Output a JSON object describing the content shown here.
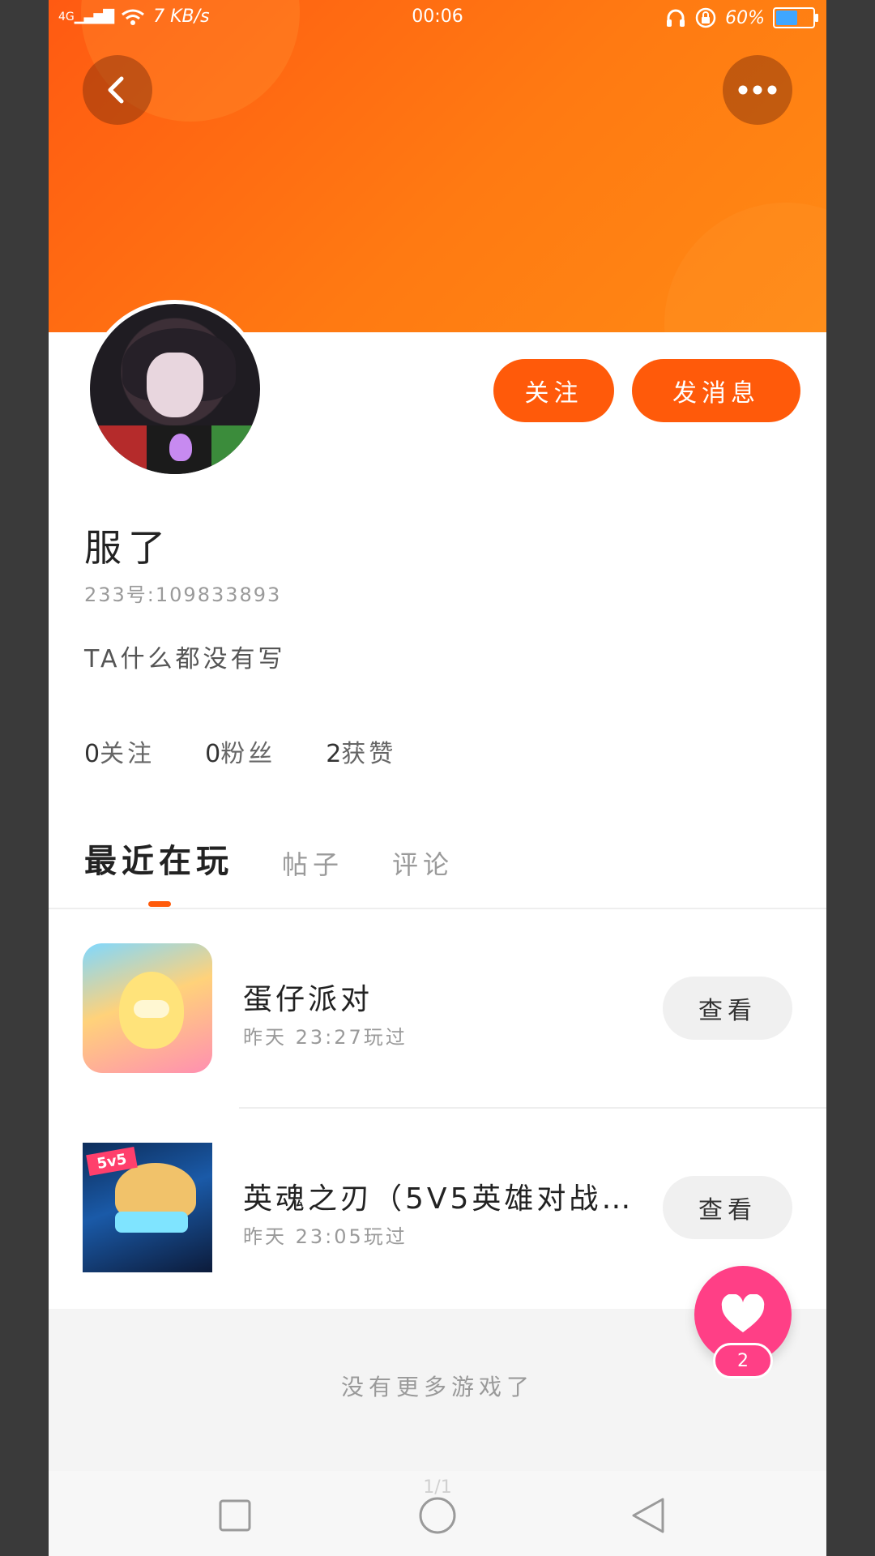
{
  "status_bar": {
    "network": "4G",
    "speed": "7 KB/s",
    "time": "00:06",
    "battery": "60%",
    "battery_level": 0.6
  },
  "header": {
    "back_icon": "chevron-left-icon",
    "more_icon": "more-horizontal-icon"
  },
  "actions": {
    "follow_label": "关注",
    "message_label": "发消息"
  },
  "profile": {
    "username": "服了",
    "id_line": "233号:109833893",
    "bio": "TA什么都没有写"
  },
  "stats": [
    {
      "num": "0",
      "label": "关注"
    },
    {
      "num": "0",
      "label": "粉丝"
    },
    {
      "num": "2",
      "label": "获赞"
    }
  ],
  "tabs": [
    {
      "label": "最近在玩",
      "active": true
    },
    {
      "label": "帖子",
      "active": false
    },
    {
      "label": "评论",
      "active": false
    }
  ],
  "games": [
    {
      "title": "蛋仔派对",
      "time": "昨天 23:27玩过",
      "button": "查看"
    },
    {
      "title": "英魂之刃（5V5英雄对战…",
      "time": "昨天 23:05玩过",
      "button": "查看"
    }
  ],
  "footer": {
    "no_more": "没有更多游戏了"
  },
  "like": {
    "count": "2",
    "icon": "heart-icon"
  },
  "nav": {
    "page_indicator": "1/1"
  },
  "colors": {
    "accent": "#ff5a0a",
    "like": "#ff3f86"
  }
}
